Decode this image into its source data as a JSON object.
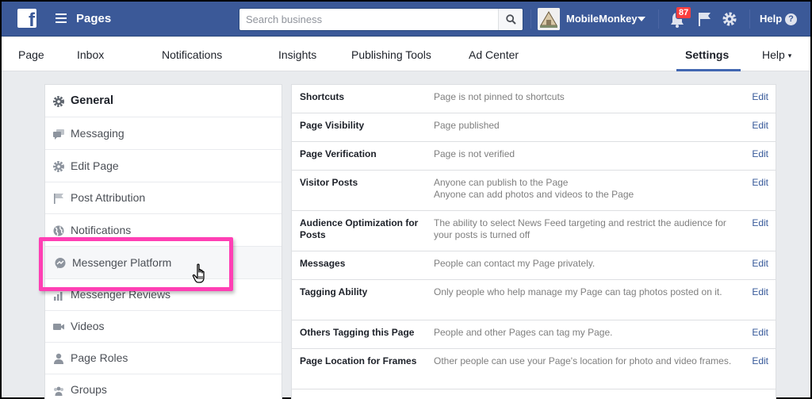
{
  "topbar": {
    "logo_letter": "f",
    "app_title": "Pages",
    "search": {
      "placeholder": "Search business",
      "value": ""
    },
    "profile_name": "MobileMonkey",
    "notification_count": "87",
    "help_label": "Help",
    "help_icon": "?",
    "colors": {
      "bar": "#3b5998",
      "badge": "#fa3e3e"
    }
  },
  "tabs": [
    {
      "label": "Page"
    },
    {
      "label": "Inbox"
    },
    {
      "label": "Notifications"
    },
    {
      "label": "Insights"
    },
    {
      "label": "Publishing Tools"
    },
    {
      "label": "Ad Center"
    },
    {
      "label": "Settings",
      "active": true
    },
    {
      "label": "Help",
      "caret": "▾"
    }
  ],
  "sidebar": {
    "items": [
      {
        "label": "General",
        "icon": "gear-icon",
        "active": true
      },
      {
        "label": "Messaging",
        "icon": "chat-bubbles-icon"
      },
      {
        "label": "Edit Page",
        "icon": "gear-icon"
      },
      {
        "label": "Post Attribution",
        "icon": "flag-icon"
      },
      {
        "label": "Notifications",
        "icon": "globe-icon"
      },
      {
        "label": "Messenger Platform",
        "icon": "messenger-icon"
      },
      {
        "label": "Messenger Reviews",
        "icon": "bar-chart-icon"
      },
      {
        "label": "Videos",
        "icon": "video-camera-icon"
      },
      {
        "label": "Page Roles",
        "icon": "person-icon"
      },
      {
        "label": "Groups",
        "icon": "people-icon"
      }
    ]
  },
  "settings": {
    "edit_label": "Edit",
    "rows": [
      {
        "name": "Shortcuts",
        "value": "Page is not pinned to shortcuts"
      },
      {
        "name": "Page Visibility",
        "value": "Page published"
      },
      {
        "name": "Page Verification",
        "value": "Page is not verified"
      },
      {
        "name": "Visitor Posts",
        "value": "Anyone can publish to the Page\nAnyone can add photos and videos to the Page"
      },
      {
        "name": "Audience Optimization for Posts",
        "value": "The ability to select News Feed targeting and restrict the audience for your posts is turned off"
      },
      {
        "name": "Messages",
        "value": "People can contact my Page privately."
      },
      {
        "name": "Tagging Ability",
        "value": "Only people who help manage my Page can tag photos posted on it."
      },
      {
        "name": "Others Tagging this Page",
        "value": "People and other Pages can tag my Page."
      },
      {
        "name": "Page Location for Frames",
        "value": "Other people can use your Page's location for photo and video frames."
      }
    ]
  },
  "annotation": {
    "highlight_color": "#ff3fb4",
    "highlighted_item": "Messenger Platform"
  }
}
